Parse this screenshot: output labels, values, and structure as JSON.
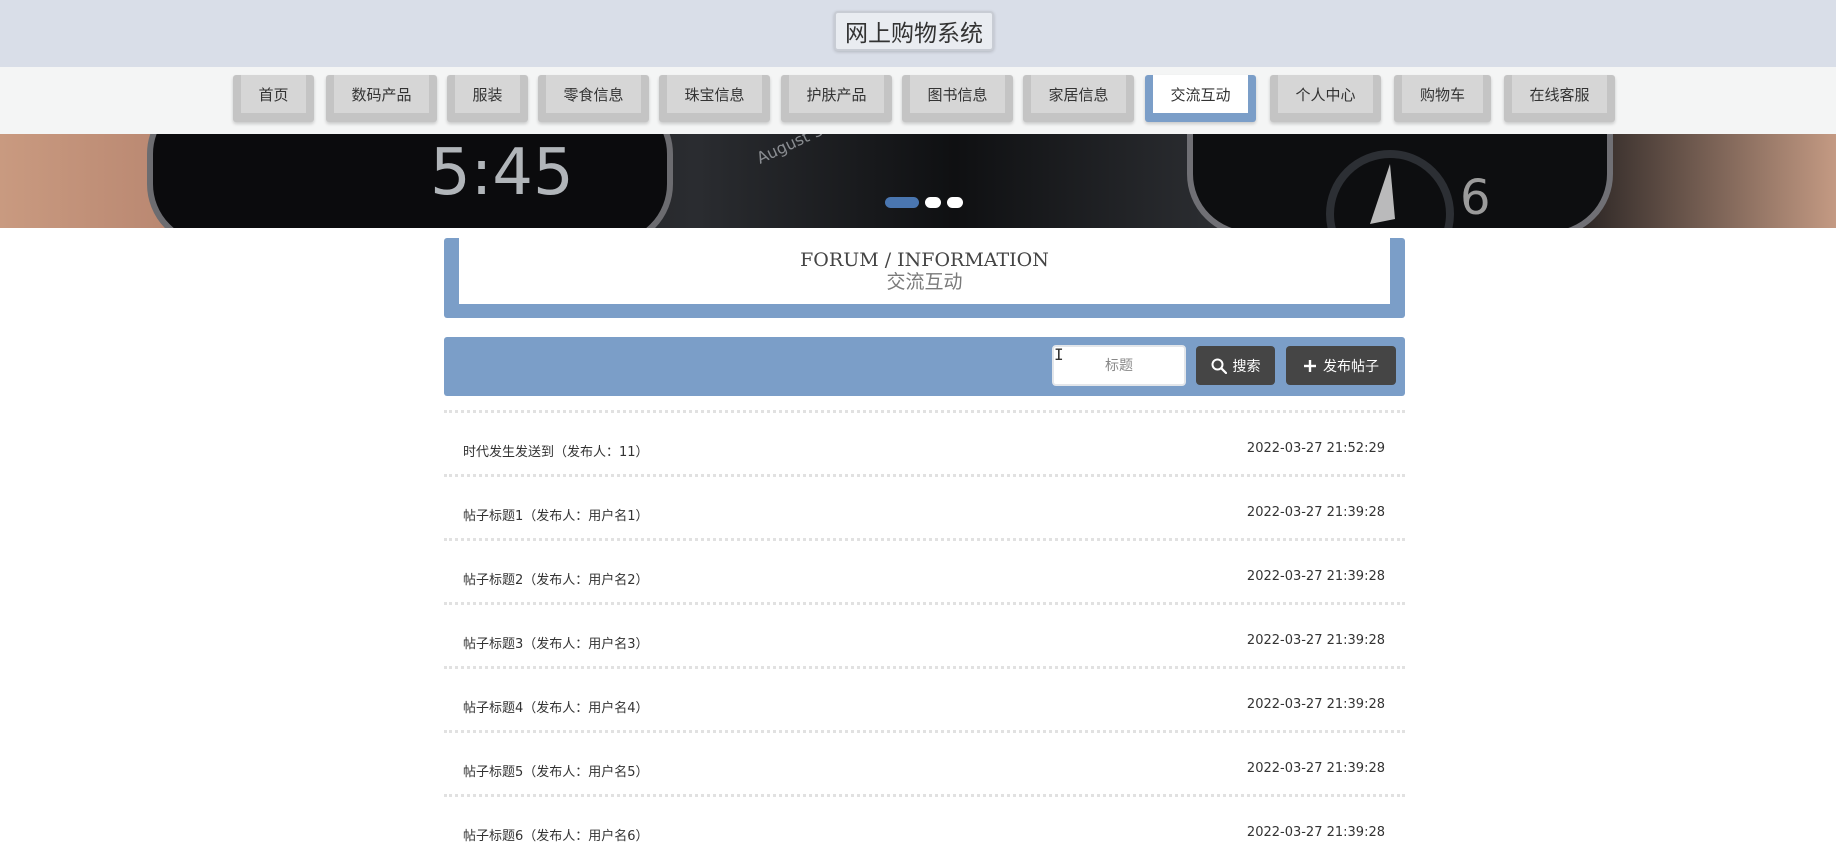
{
  "header": {
    "title": "网上购物系统"
  },
  "nav": {
    "items": [
      {
        "label": "首页"
      },
      {
        "label": "数码产品"
      },
      {
        "label": "服装"
      },
      {
        "label": "零食信息"
      },
      {
        "label": "珠宝信息"
      },
      {
        "label": "护肤产品"
      },
      {
        "label": "图书信息"
      },
      {
        "label": "家居信息"
      },
      {
        "label": "交流互动"
      },
      {
        "label": "个人中心"
      },
      {
        "label": "购物车"
      },
      {
        "label": "在线客服"
      }
    ],
    "active_index": 8
  },
  "banner": {
    "slide_count": 3,
    "active_slide": 1
  },
  "section": {
    "title_en": "FORUM / INFORMATION",
    "title_cn": "交流互动"
  },
  "search": {
    "placeholder": "标题",
    "search_label": "搜索",
    "post_label": "发布帖子"
  },
  "posts": [
    {
      "title": "时代发生发送到（发布人：11）",
      "time": "2022-03-27 21:52:29"
    },
    {
      "title": "帖子标题1（发布人：用户名1）",
      "time": "2022-03-27 21:39:28"
    },
    {
      "title": "帖子标题2（发布人：用户名2）",
      "time": "2022-03-27 21:39:28"
    },
    {
      "title": "帖子标题3（发布人：用户名3）",
      "time": "2022-03-27 21:39:28"
    },
    {
      "title": "帖子标题4（发布人：用户名4）",
      "time": "2022-03-27 21:39:28"
    },
    {
      "title": "帖子标题5（发布人：用户名5）",
      "time": "2022-03-27 21:39:28"
    },
    {
      "title": "帖子标题6（发布人：用户名6）",
      "time": "2022-03-27 21:39:28"
    }
  ],
  "colors": {
    "accent": "#7b9ec8",
    "header_bg": "#d9dee8",
    "button_dark": "#454545",
    "dot_active": "#4a76b0"
  }
}
